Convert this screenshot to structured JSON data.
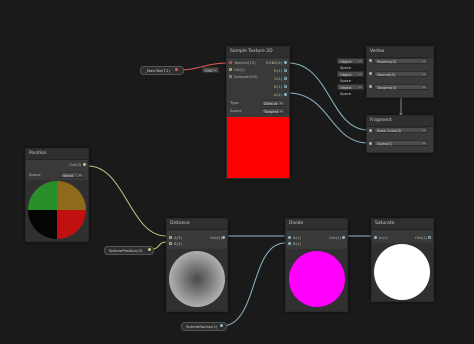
{
  "colors": {
    "background": "#1a1a1a",
    "node_body": "#393939",
    "node_header": "#2f2f2f",
    "wire_float": "#8fb5c7",
    "wire_vector": "#b6d17e",
    "wire_texture": "#e05a5a",
    "red_preview": "#ff0000",
    "magenta_preview": "#ff00ff",
    "white_preview": "#ffffff"
  },
  "properties": {
    "main_tex": "_MainTex(T2)",
    "sample_texture_pill": "SampleTexture(T2)"
  },
  "sample_texture": {
    "title": "Sample Texture 2D",
    "inputs": [
      "Texture(T2)",
      "UV(2)",
      "Sampler(SS)"
    ],
    "outputs": [
      "RGBA(4)",
      "R(1)",
      "G(1)",
      "B(1)",
      "A(1)"
    ],
    "uv_dropdown": "UV0",
    "type_label": "Type",
    "type_value": "Default",
    "space_label": "Space",
    "space_value": "Tangent"
  },
  "vertex": {
    "title": "Vertex",
    "rows": [
      {
        "chip": "Object Space",
        "label": "Position(3)"
      },
      {
        "chip": "Object Space",
        "label": "Normal(3)"
      },
      {
        "chip": "Object Space",
        "label": "Tangent(3)"
      }
    ]
  },
  "fragment": {
    "title": "Fragment",
    "rows": [
      "Base Color(3)",
      "Alpha(1)"
    ]
  },
  "position_node": {
    "title": "Position",
    "output": "Out(3)",
    "space_label": "Space",
    "space_value": "World"
  },
  "distance_node": {
    "title": "Distance",
    "inputs": [
      "A(3)",
      "B(3)"
    ],
    "output": "Out(1)"
  },
  "divide_node": {
    "title": "Divide",
    "inputs": [
      "A(1)",
      "B(1)"
    ],
    "output": "Out(1)"
  },
  "saturate_node": {
    "title": "Saturate",
    "input": "In(1)",
    "output": "Out(1)"
  },
  "pills": {
    "sphere_position": "SpherePosition(3)",
    "sphere_radius": "SphereRadius(1)"
  }
}
